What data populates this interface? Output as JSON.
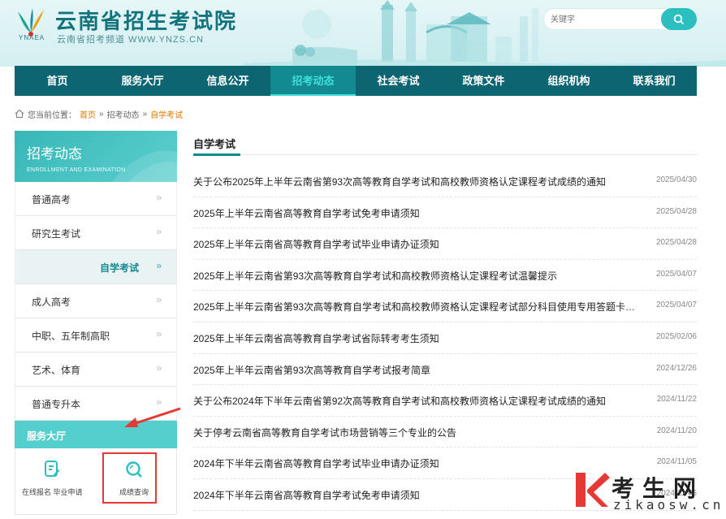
{
  "header": {
    "site_title": "云南省招生考试院",
    "site_subtitle": "云南省招考频道 WWW.YNZS.CN",
    "logo_text": "YNAEA",
    "search": {
      "placeholder": "关键字"
    }
  },
  "nav": {
    "items": [
      {
        "label": "首页",
        "active": false
      },
      {
        "label": "服务大厅",
        "active": false
      },
      {
        "label": "信息公开",
        "active": false
      },
      {
        "label": "招考动态",
        "active": true
      },
      {
        "label": "社会考试",
        "active": false
      },
      {
        "label": "政策文件",
        "active": false
      },
      {
        "label": "组织机构",
        "active": false
      },
      {
        "label": "联系我们",
        "active": false
      }
    ]
  },
  "breadcrumb": {
    "prefix": "您当前位置：",
    "home": "首页",
    "sep1": "»",
    "section": "招考动态",
    "sep2": "»",
    "current": "自学考试"
  },
  "sidebar": {
    "title": "招考动态",
    "title_en": "ENROLLMENT AND EXAMINATION",
    "chevron": "»",
    "items": [
      {
        "label": "普通高考",
        "active": false
      },
      {
        "label": "研究生考试",
        "active": false
      },
      {
        "label": "自学考试",
        "active": true
      },
      {
        "label": "成人高考",
        "active": false
      },
      {
        "label": "中职、五年制高职",
        "active": false
      },
      {
        "label": "艺术、体育",
        "active": false
      },
      {
        "label": "普通专升本",
        "active": false
      }
    ],
    "service": {
      "title": "服务大厅",
      "items": [
        {
          "label": "在线报名 毕业申请",
          "icon": "document-icon"
        },
        {
          "label": "成绩查询",
          "icon": "search-icon"
        }
      ]
    }
  },
  "main": {
    "title": "自学考试",
    "news": [
      {
        "title": "关于公布2025年上半年云南省第93次高等教育自学考试和高校教师资格认定课程考试成绩的通知",
        "date": "2025/04/30"
      },
      {
        "title": "2025年上半年云南省高等教育自学考试免考申请须知",
        "date": "2025/04/28"
      },
      {
        "title": "2025年上半年云南省高等教育自学考试毕业申请办证须知",
        "date": "2025/04/28"
      },
      {
        "title": "2025年上半年云南省第93次高等教育自学考试和高校教师资格认定课程考试温馨提示",
        "date": "2025/04/07"
      },
      {
        "title": "2025年上半年云南省第93次高等教育自学考试和高校教师资格认定课程考试部分科目使用专用答题卡的说明",
        "date": "2025/04/07"
      },
      {
        "title": "2025年上半年云南省高等教育自学考试省际转考考生须知",
        "date": "2025/02/06"
      },
      {
        "title": "2025年上半年云南省第93次高等教育自学考试报考简章",
        "date": "2024/12/26"
      },
      {
        "title": "关于公布2024年下半年云南省第92次高等教育自学考试和高校教师资格认定课程考试成绩的通知",
        "date": "2024/11/22"
      },
      {
        "title": "关于停考云南省高等教育自学考试市场营销等三个专业的公告",
        "date": "2024/11/20"
      },
      {
        "title": "2024年下半年云南省高等教育自学考试毕业申请办证须知",
        "date": "2024/11/05"
      },
      {
        "title": "2024年下半年云南省高等教育自学考试免考申请须知",
        "date": "2024/11/05"
      }
    ]
  },
  "watermark": {
    "cn": "考生网",
    "en": "zikaosw.cn"
  },
  "colors": {
    "primary": "#0e6572",
    "accent": "#2bbfbf",
    "highlight": "#e07a00",
    "annotation": "#e53935"
  }
}
